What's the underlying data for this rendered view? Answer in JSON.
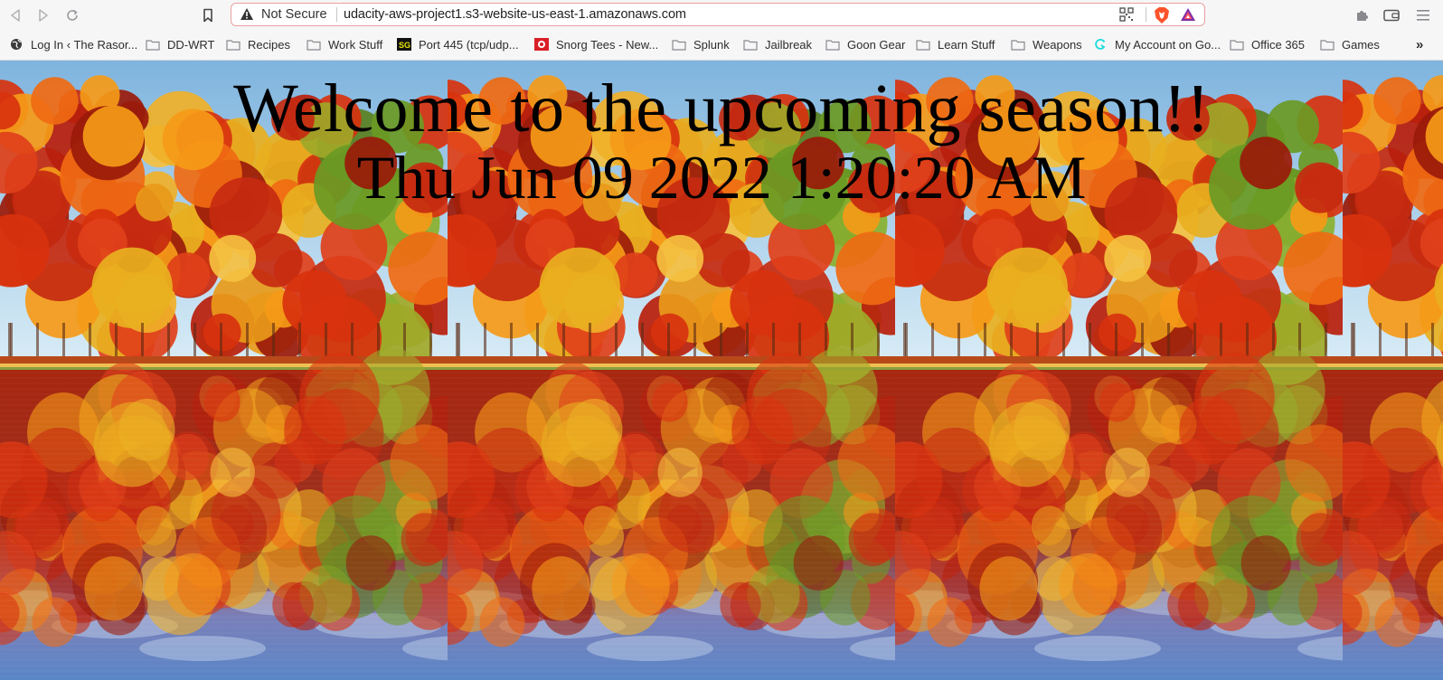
{
  "browser": {
    "url_security": "Not Secure",
    "url": "udacity-aws-project1.s3-website-us-east-1.amazonaws.com",
    "toolbar_icons": [
      "back-icon",
      "forward-icon",
      "reload-icon",
      "bookmark-icon",
      "extensions-icon",
      "wallet-icon",
      "menu-icon"
    ],
    "bookmarks": [
      {
        "label": "Log In ‹ The Rasor...",
        "icon": "globe-icon"
      },
      {
        "label": "DD-WRT",
        "icon": "folder-icon"
      },
      {
        "label": "Recipes",
        "icon": "folder-icon"
      },
      {
        "label": "Work Stuff",
        "icon": "folder-icon"
      },
      {
        "label": "Port 445 (tcp/udp...",
        "icon": "sg-icon"
      },
      {
        "label": "Snorg Tees - New...",
        "icon": "snorg-icon"
      },
      {
        "label": "Splunk",
        "icon": "folder-icon"
      },
      {
        "label": "Jailbreak",
        "icon": "folder-icon"
      },
      {
        "label": "Goon Gear",
        "icon": "folder-icon"
      },
      {
        "label": "Learn Stuff",
        "icon": "folder-icon"
      },
      {
        "label": "Weapons",
        "icon": "folder-icon"
      },
      {
        "label": "My Account on Go...",
        "icon": "godaddy-icon"
      },
      {
        "label": "Office 365",
        "icon": "folder-icon"
      },
      {
        "label": "Games",
        "icon": "folder-icon"
      }
    ],
    "overflow_label": "»"
  },
  "page": {
    "headline": "Welcome to the upcoming season!!",
    "datetime": "Thu Jun 09 2022 1:20:20 AM",
    "background": "autumn-lake-tiled-image"
  }
}
